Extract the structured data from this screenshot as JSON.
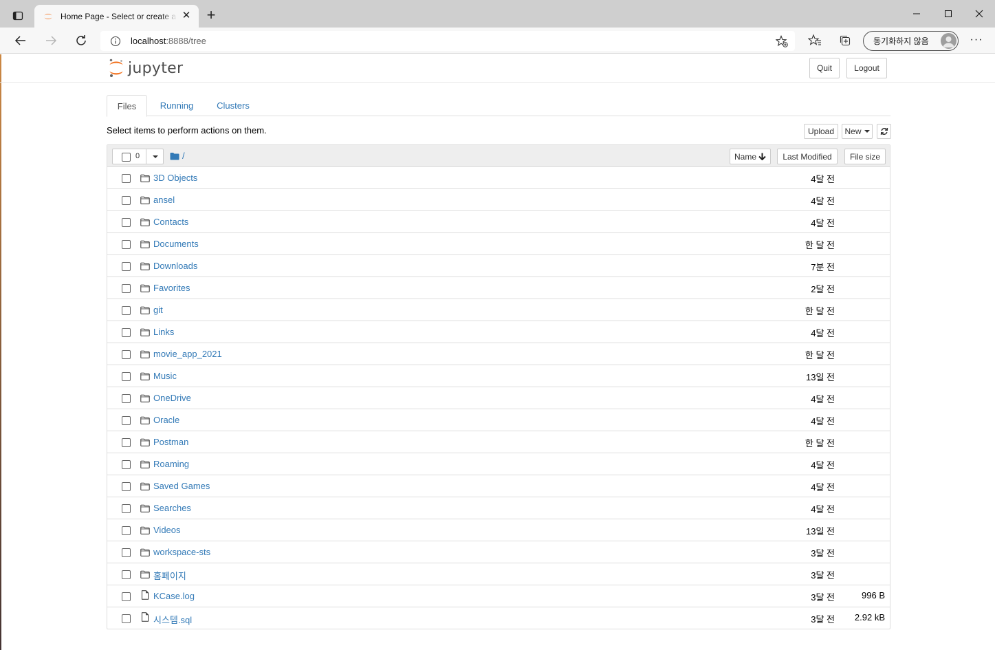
{
  "browser": {
    "tab_title": "Home Page - Select or create a new notebook",
    "address_host": "localhost",
    "address_path": ":8888/tree",
    "profile_label": "동기화하지 않음"
  },
  "header": {
    "logo_text": "jupyter",
    "quit_label": "Quit",
    "logout_label": "Logout"
  },
  "tabs": [
    {
      "label": "Files"
    },
    {
      "label": "Running"
    },
    {
      "label": "Clusters"
    }
  ],
  "notice": "Select items to perform actions on them.",
  "actions": {
    "upload_label": "Upload",
    "new_label": "New"
  },
  "list_header": {
    "selected_count": "0",
    "breadcrumb": "/",
    "sort_name": "Name",
    "sort_modified": "Last Modified",
    "sort_size": "File size"
  },
  "files": [
    {
      "name": "3D Objects",
      "type": "folder",
      "modified": "4달 전",
      "size": ""
    },
    {
      "name": "ansel",
      "type": "folder",
      "modified": "4달 전",
      "size": ""
    },
    {
      "name": "Contacts",
      "type": "folder",
      "modified": "4달 전",
      "size": ""
    },
    {
      "name": "Documents",
      "type": "folder",
      "modified": "한 달 전",
      "size": ""
    },
    {
      "name": "Downloads",
      "type": "folder",
      "modified": "7분 전",
      "size": ""
    },
    {
      "name": "Favorites",
      "type": "folder",
      "modified": "2달 전",
      "size": ""
    },
    {
      "name": "git",
      "type": "folder",
      "modified": "한 달 전",
      "size": ""
    },
    {
      "name": "Links",
      "type": "folder",
      "modified": "4달 전",
      "size": ""
    },
    {
      "name": "movie_app_2021",
      "type": "folder",
      "modified": "한 달 전",
      "size": ""
    },
    {
      "name": "Music",
      "type": "folder",
      "modified": "13일 전",
      "size": ""
    },
    {
      "name": "OneDrive",
      "type": "folder",
      "modified": "4달 전",
      "size": ""
    },
    {
      "name": "Oracle",
      "type": "folder",
      "modified": "4달 전",
      "size": ""
    },
    {
      "name": "Postman",
      "type": "folder",
      "modified": "한 달 전",
      "size": ""
    },
    {
      "name": "Roaming",
      "type": "folder",
      "modified": "4달 전",
      "size": ""
    },
    {
      "name": "Saved Games",
      "type": "folder",
      "modified": "4달 전",
      "size": ""
    },
    {
      "name": "Searches",
      "type": "folder",
      "modified": "4달 전",
      "size": ""
    },
    {
      "name": "Videos",
      "type": "folder",
      "modified": "13일 전",
      "size": ""
    },
    {
      "name": "workspace-sts",
      "type": "folder",
      "modified": "3달 전",
      "size": ""
    },
    {
      "name": "홈페이지",
      "type": "folder",
      "modified": "3달 전",
      "size": ""
    },
    {
      "name": "KCase.log",
      "type": "file",
      "modified": "3달 전",
      "size": "996 B"
    },
    {
      "name": "시스템.sql",
      "type": "file",
      "modified": "3달 전",
      "size": "2.92 kB"
    }
  ],
  "colors": {
    "link": "#337ab7",
    "jupyter_orange": "#f37726"
  }
}
